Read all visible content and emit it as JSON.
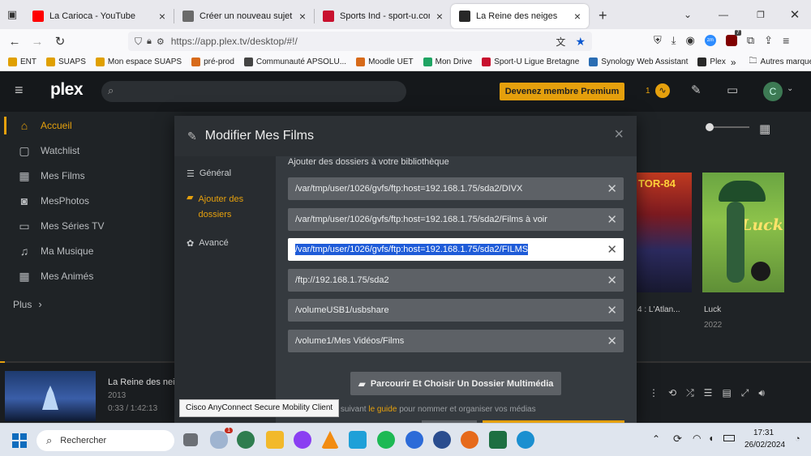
{
  "browser": {
    "tabs": [
      {
        "title": "La Carioca - YouTube",
        "favicon_color": "#ff0000",
        "active": false
      },
      {
        "title": "Créer un nouveau sujet - NAS-F",
        "favicon_color": "#6a6a6a",
        "active": false
      },
      {
        "title": "Sports Ind - sport-u.com",
        "favicon_color": "#c8102e",
        "active": false
      },
      {
        "title": "La Reine des neiges",
        "favicon_color": "#282828",
        "active": true
      }
    ],
    "new_tab": "+",
    "url": "https://app.plex.tv/desktop/#!/",
    "bookmarks": [
      {
        "label": "ENT",
        "color": "#e0a000"
      },
      {
        "label": "SUAPS",
        "color": "#e0a000"
      },
      {
        "label": "Mon espace SUAPS",
        "color": "#e0a000"
      },
      {
        "label": "pré-prod",
        "color": "#d76a1a"
      },
      {
        "label": "Communauté APSOLU...",
        "color": "#444444"
      },
      {
        "label": "Moodle UET",
        "color": "#d76a1a"
      },
      {
        "label": "Mon Drive",
        "color": "#1fa463"
      },
      {
        "label": "Sport-U Ligue Bretagne",
        "color": "#c8102e"
      },
      {
        "label": "Synology Web Assistant",
        "color": "#2a6db3"
      },
      {
        "label": "Plex",
        "color": "#282828"
      }
    ],
    "other_bookmarks": "Autres marque-pages",
    "badge_count": "7"
  },
  "plex": {
    "logo": "plex",
    "premium_label": "Devenez membre Premium",
    "activity_count": "1",
    "avatar_letter": "C",
    "sidebar": [
      {
        "label": "Accueil",
        "icon": "home-icon",
        "glyph": "⌂",
        "active": true
      },
      {
        "label": "Watchlist",
        "icon": "bookmark-icon",
        "glyph": "▢",
        "active": false
      },
      {
        "label": "Mes Films",
        "icon": "film-icon",
        "glyph": "▦",
        "active": false
      },
      {
        "label": "MesPhotos",
        "icon": "camera-icon",
        "glyph": "◙",
        "active": false
      },
      {
        "label": "Mes Séries TV",
        "icon": "tv-icon",
        "glyph": "▭",
        "active": false
      },
      {
        "label": "Ma Musique",
        "icon": "music-icon",
        "glyph": "♫",
        "active": false
      },
      {
        "label": "Mes Animés",
        "icon": "film-icon",
        "glyph": "▦",
        "active": false
      }
    ],
    "more_label": "Plus",
    "bg_cards": [
      {
        "title": "4 : L'Atlan...",
        "year": ""
      },
      {
        "title": "Luck",
        "year": "2022"
      }
    ],
    "poster_text": "Luck",
    "poster_partial_text": "TOR-84",
    "now_playing": {
      "title": "La Reine des neige",
      "year": "2013",
      "time": "0:33 / 1:42:13"
    }
  },
  "modal": {
    "title": "Modifier Mes Films",
    "close": "×",
    "tabs": [
      {
        "label": "Général",
        "icon": "list-icon",
        "glyph": "☰",
        "active": false
      },
      {
        "label": "Ajouter des dossiers",
        "icon": "folder-icon",
        "glyph": "▰",
        "active": true
      },
      {
        "label": "Avancé",
        "icon": "gear-icon",
        "glyph": "✿",
        "active": false
      }
    ],
    "section_label": "Ajouter des dossiers à votre bibliothèque",
    "folders": [
      {
        "path": "/var/tmp/user/1026/gvfs/ftp:host=192.168.1.75/sda2/DIVX",
        "selected": false
      },
      {
        "path": "/var/tmp/user/1026/gvfs/ftp:host=192.168.1.75/sda2/Films à voir",
        "selected": false
      },
      {
        "path": "/var/tmp/user/1026/gvfs/ftp:host=192.168.1.75/sda2/FILMS",
        "selected": true
      },
      {
        "path": "/ftp://192.168.1.75/sda2",
        "selected": false
      },
      {
        "path": "/volumeUSB1/usbshare",
        "selected": false
      },
      {
        "path": "/volume1/Mes Vidéos/Films",
        "selected": false
      }
    ],
    "remove_glyph": "✕",
    "browse_label": "Parcourir Et Choisir Un Dossier Multimédia",
    "hint_prefix": "en suivant",
    "hint_link": "le guide",
    "hint_suffix": "pour nommer et organiser vos médias"
  },
  "tooltip": "Cisco AnyConnect Secure Mobility Client",
  "taskbar": {
    "search_placeholder": "Rechercher",
    "clock_time": "17:31",
    "clock_date": "26/02/2024",
    "weather_badge": "1"
  }
}
